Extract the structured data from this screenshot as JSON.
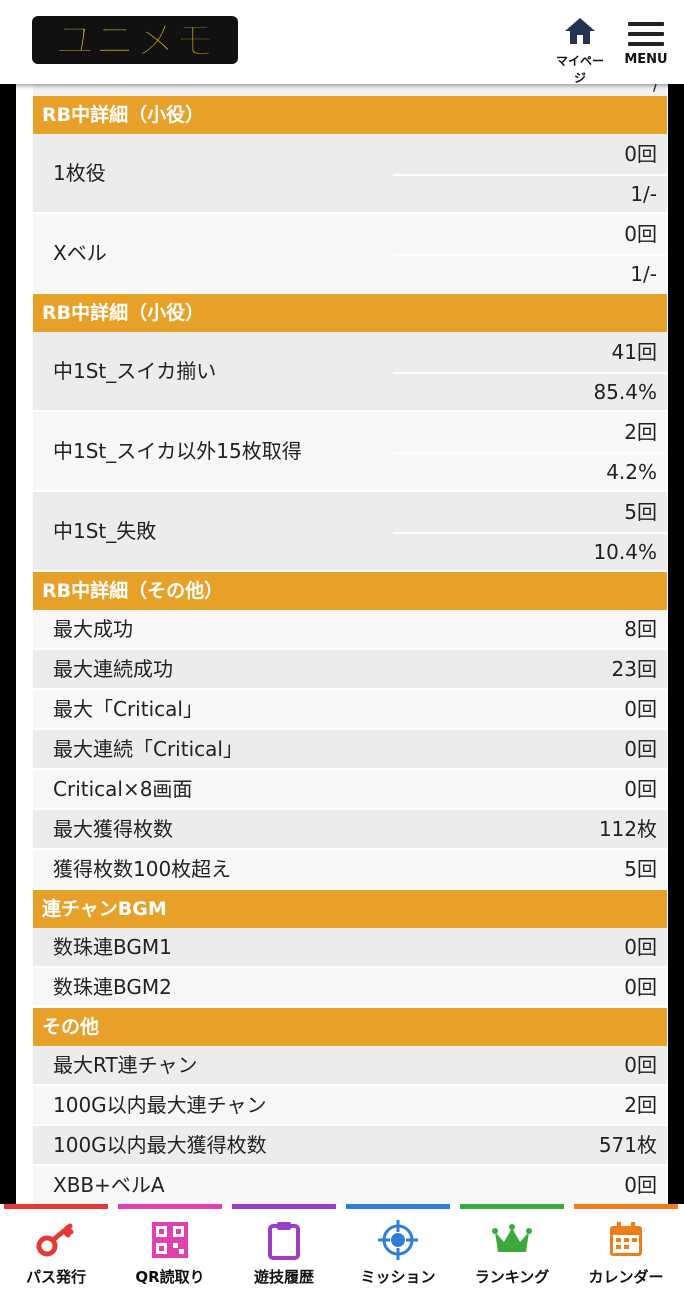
{
  "header": {
    "logo_text": "ユニメモ",
    "mypage_label": "マイページ",
    "menu_label": "MENU",
    "cut_row_value": "/"
  },
  "sections": [
    {
      "title": "RB中詳細（小役）",
      "rows": [
        {
          "name": "1枚役",
          "count": "0回",
          "rate": "1/-"
        },
        {
          "name": "Xベル",
          "count": "0回",
          "rate": "1/-"
        }
      ]
    },
    {
      "title": "RB中詳細（小役）",
      "rows": [
        {
          "name": "中1St_スイカ揃い",
          "count": "41回",
          "rate": "85.4%"
        },
        {
          "name": "中1St_スイカ以外15枚取得",
          "count": "2回",
          "rate": "4.2%"
        },
        {
          "name": "中1St_失敗",
          "count": "5回",
          "rate": "10.4%"
        }
      ]
    },
    {
      "title": "RB中詳細（その他）",
      "rows": [
        {
          "name": "最大成功",
          "value": "8回"
        },
        {
          "name": "最大連続成功",
          "value": "23回"
        },
        {
          "name": "最大「Critical」",
          "value": "0回"
        },
        {
          "name": "最大連続「Critical」",
          "value": "0回"
        },
        {
          "name": "Critical×8画面",
          "value": "0回"
        },
        {
          "name": "最大獲得枚数",
          "value": "112枚"
        },
        {
          "name": "獲得枚数100枚超え",
          "value": "5回"
        }
      ]
    },
    {
      "title": "連チャンBGM",
      "rows": [
        {
          "name": "数珠連BGM1",
          "value": "0回"
        },
        {
          "name": "数珠連BGM2",
          "value": "0回"
        }
      ]
    },
    {
      "title": "その他",
      "rows": [
        {
          "name": "最大RT連チャン",
          "value": "0回"
        },
        {
          "name": "100G以内最大連チャン",
          "value": "2回"
        },
        {
          "name": "100G以内最大獲得枚数",
          "value": "571枚"
        },
        {
          "name": "XBB+ベルA",
          "value": "0回"
        }
      ]
    }
  ],
  "bottom_nav": [
    {
      "label": "パス発行",
      "icon": "key-icon",
      "color": "#e53935"
    },
    {
      "label": "QR読取り",
      "icon": "qr-code-icon",
      "color": "#e040b0"
    },
    {
      "label": "遊技履歴",
      "icon": "clipboard-icon",
      "color": "#9c3fc8"
    },
    {
      "label": "ミッション",
      "icon": "target-icon",
      "color": "#2f7fd8"
    },
    {
      "label": "ランキング",
      "icon": "crown-icon",
      "color": "#3aa83a"
    },
    {
      "label": "カレンダー",
      "icon": "calendar-icon",
      "color": "#ef7d1a"
    }
  ],
  "colors": {
    "section_header": "#e8a128",
    "row_gray": "#ececec",
    "row_light": "#f7f7f7"
  }
}
